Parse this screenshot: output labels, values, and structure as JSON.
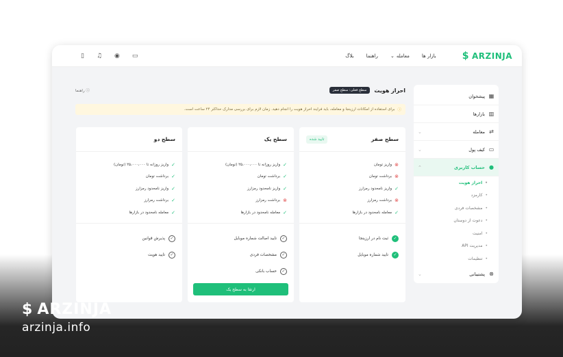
{
  "brand": {
    "name": "ARZINJA",
    "accent": "#1fbf7a"
  },
  "topbar": {
    "nav": [
      "بازار ها",
      "معامله",
      "راهنما",
      "بلاگ"
    ],
    "icons": [
      "mobile-icon",
      "bell-icon",
      "user-icon",
      "wallet-icon"
    ]
  },
  "sidebar": {
    "items": [
      {
        "label": "پیشخوان",
        "icon": "grid-icon"
      },
      {
        "label": "بازارها",
        "icon": "chart-icon"
      },
      {
        "label": "معامله",
        "icon": "exchange-icon"
      },
      {
        "label": "کیف پول",
        "icon": "wallet-icon"
      },
      {
        "label": "حساب کاربری",
        "icon": "user-icon"
      }
    ],
    "sub": [
      "احراز هویت",
      "کارمزد",
      "مشخصات فردی",
      "دعوت از دوستان",
      "امنیت",
      "مدیریت API",
      "تنظیمات"
    ],
    "support": "پشتیبانی"
  },
  "page": {
    "title": "احراز هویت",
    "level_badge": "سطح فعلی: سطح صفر",
    "help": "راهنما",
    "alert": "برای استفاده از امکانات ارزینجا و معامله، باید فرایند احراز هویت را انجام دهید. زمان لازم برای بررسی مدارک حداکثر ۲۴ ساعت است."
  },
  "cards": [
    {
      "title": "سطح صفر",
      "status": "تایید شده",
      "features": [
        {
          "text": "واریز تومان",
          "ok": false
        },
        {
          "text": "برداشت تومان",
          "ok": false
        },
        {
          "text": "واریز نامحدود رمزارز",
          "ok": true
        },
        {
          "text": "برداشت رمزارز",
          "ok": false
        },
        {
          "text": "معامله نامحدود در بازارها",
          "ok": true
        }
      ],
      "reqs": [
        "ثبت نام در ارزینجا",
        "تایید شماره موبایل"
      ]
    },
    {
      "title": "سطح یک",
      "features": [
        {
          "text": "واریز روزانه تا ۲۵،۰۰۰،۰۰۰ (تومان)",
          "ok": true
        },
        {
          "text": "برداشت تومان",
          "ok": true
        },
        {
          "text": "واریز نامحدود رمزارز",
          "ok": true
        },
        {
          "text": "برداشت رمزارز",
          "ok": false
        },
        {
          "text": "معامله نامحدود در بازارها",
          "ok": true
        }
      ],
      "reqs": [
        "تایید اصالت شماره موبایل",
        "مشخصات فردی",
        "حساب بانکی"
      ],
      "button": "ارتقا به سطح یک"
    },
    {
      "title": "سطح دو",
      "features": [
        {
          "text": "واریز روزانه تا ۲۵،۰۰۰،۰۰۰ (تومان)",
          "ok": true
        },
        {
          "text": "برداشت تومان",
          "ok": true
        },
        {
          "text": "واریز نامحدود رمزارز",
          "ok": true
        },
        {
          "text": "برداشت رمزارز",
          "ok": true
        },
        {
          "text": "معامله نامحدود در بازارها",
          "ok": true
        }
      ],
      "reqs": [
        "پذیرش قوانین",
        "تایید هویت"
      ]
    }
  ],
  "watermark": {
    "brand": "ARZINJA",
    "url": "arzinja.info"
  }
}
